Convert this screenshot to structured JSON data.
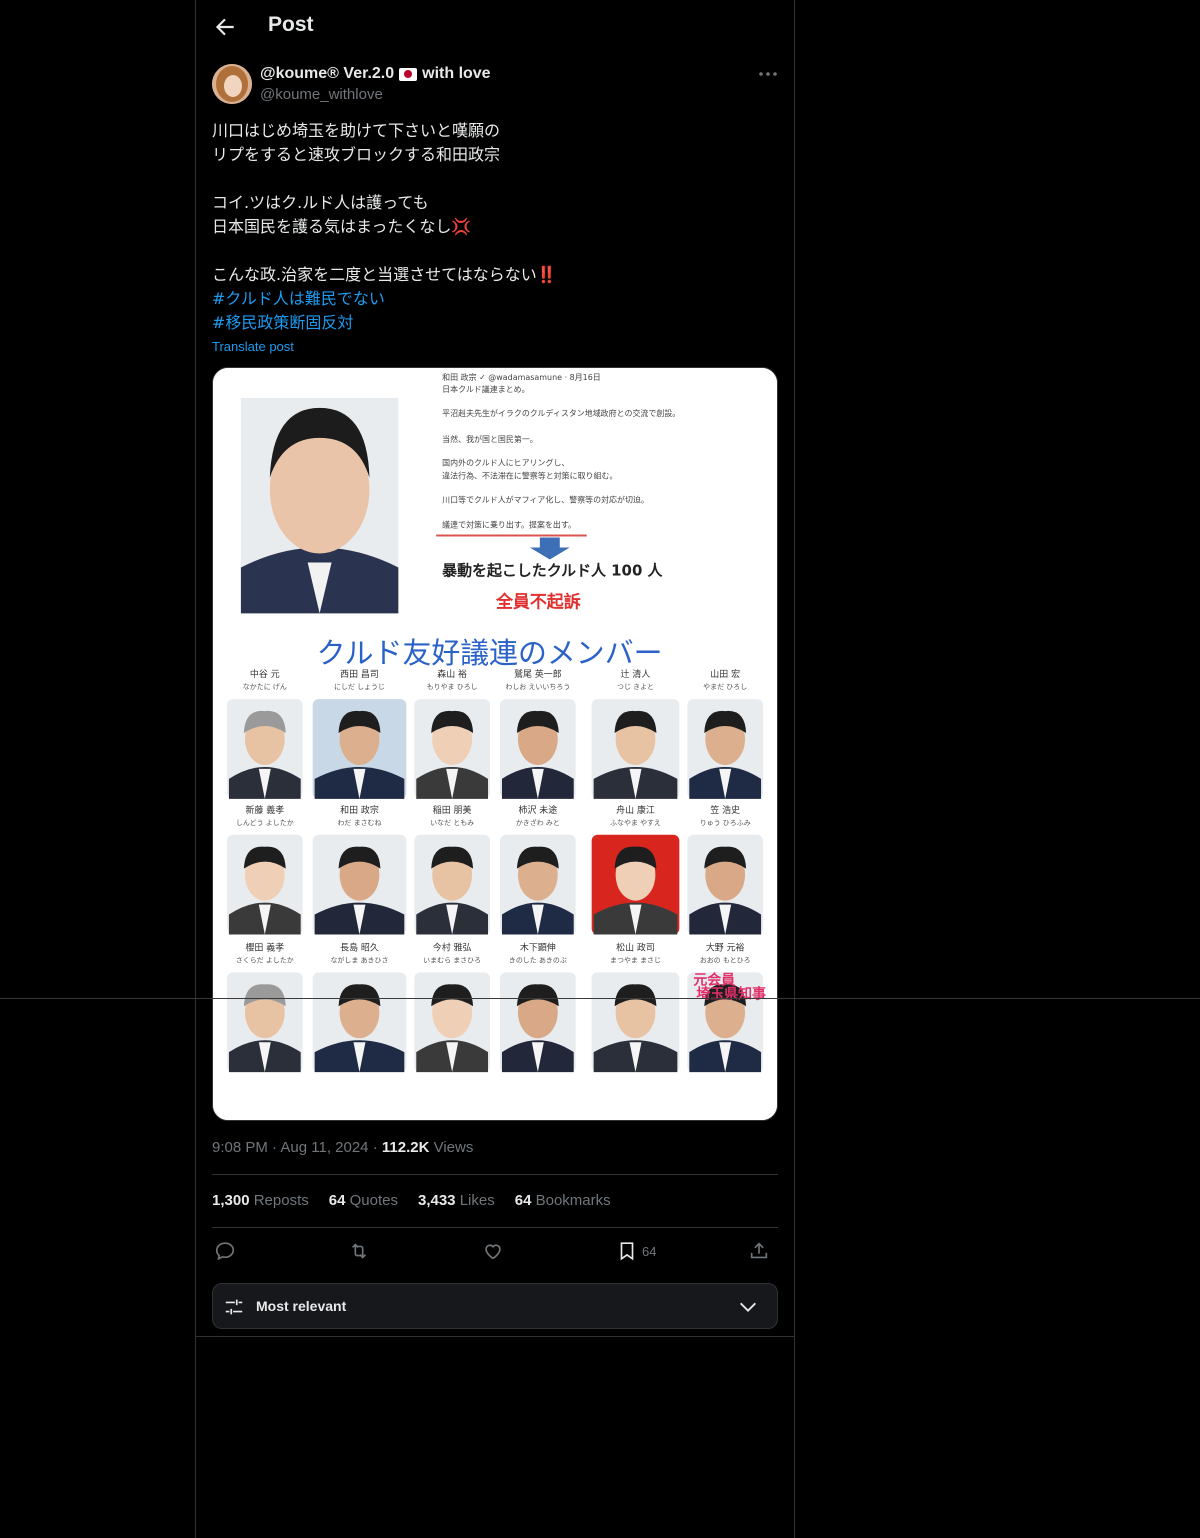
{
  "header": {
    "title": "Post"
  },
  "author": {
    "display_name_prefix": "@koume® Ver.2.0",
    "display_name_suffix": "with love",
    "handle": "@koume_withlove"
  },
  "post": {
    "lines": [
      "川口はじめ埼玉を助けて下さいと嘆願の",
      "リプをすると速攻ブロックする和田政宗",
      "",
      "コイ.ツはク.ルド人は護っても",
      "日本国民を護る気はまったくなし💢",
      "",
      "こんな政.治家を二度と当選させてはならない‼️"
    ],
    "hashtags": [
      "#クルド人は難民でない",
      "#移民政策断固反対"
    ],
    "translate_label": "Translate post"
  },
  "media": {
    "tweet_header": "和田 政宗 ✓ @wadamasamune · 8月16日",
    "tweet_lines": [
      "日本クルド議連まとめ。",
      "平沼赳夫先生がイラクのクルディスタン地域政府との交流で創設。",
      "当然、我が国と国民第一。",
      "国内外のクルド人にヒアリングし、",
      "違法行為、不法滞在に警察等と対策に取り組む。",
      "川口等でクルド人がマフィア化し、警察等の対応が切迫。",
      "議連で対策に乗り出す。提案を出す。"
    ],
    "headline": "暴動を起こしたクルド人 100 人",
    "subheadline": "全員不起訴",
    "group_title": "クルド友好議連のメンバー",
    "members": [
      {
        "name": "中谷 元",
        "reading": "なかたに げん"
      },
      {
        "name": "西田 昌司",
        "reading": "にしだ しょうじ"
      },
      {
        "name": "森山 裕",
        "reading": "もりやま ひろし"
      },
      {
        "name": "鷲尾 英一郎",
        "reading": "わしお えいいちろう"
      },
      {
        "name": "辻 清人",
        "reading": "つじ きよと"
      },
      {
        "name": "山田 宏",
        "reading": "やまだ ひろし"
      },
      {
        "name": "新藤 義孝",
        "reading": "しんどう よしたか"
      },
      {
        "name": "和田 政宗",
        "reading": "わだ まさむね"
      },
      {
        "name": "稲田 朋美",
        "reading": "いなだ ともみ"
      },
      {
        "name": "柿沢 未途",
        "reading": "かきざわ みと"
      },
      {
        "name": "舟山 康江",
        "reading": "ふなやま やすえ"
      },
      {
        "name": "笠 浩史",
        "reading": "りゅう ひろふみ"
      },
      {
        "name": "櫻田 義孝",
        "reading": "さくらだ よしたか"
      },
      {
        "name": "長島 昭久",
        "reading": "ながしま あきひさ"
      },
      {
        "name": "今村 雅弘",
        "reading": "いまむら まさひろ"
      },
      {
        "name": "木下顕伸",
        "reading": "きのした あきのぶ"
      },
      {
        "name": "松山 政司",
        "reading": "まつやま まさじ"
      },
      {
        "name": "大野 元裕",
        "reading": "おおの もとひろ"
      }
    ],
    "stamp": "元会員\n埼玉県知事"
  },
  "meta": {
    "time": "9:08 PM",
    "date": "Aug 11, 2024",
    "views_count": "112.2K",
    "views_label": "Views"
  },
  "stats": {
    "reposts_count": "1,300",
    "reposts_label": "Reposts",
    "quotes_count": "64",
    "quotes_label": "Quotes",
    "likes_count": "3,433",
    "likes_label": "Likes",
    "bookmarks_count": "64",
    "bookmarks_label": "Bookmarks"
  },
  "actions": {
    "bookmark_count": "64"
  },
  "sort": {
    "label": "Most relevant"
  },
  "colors": {
    "accent": "#1d9bf0",
    "text": "#e7e9ea",
    "muted": "#71767b",
    "border": "#2f3336"
  }
}
